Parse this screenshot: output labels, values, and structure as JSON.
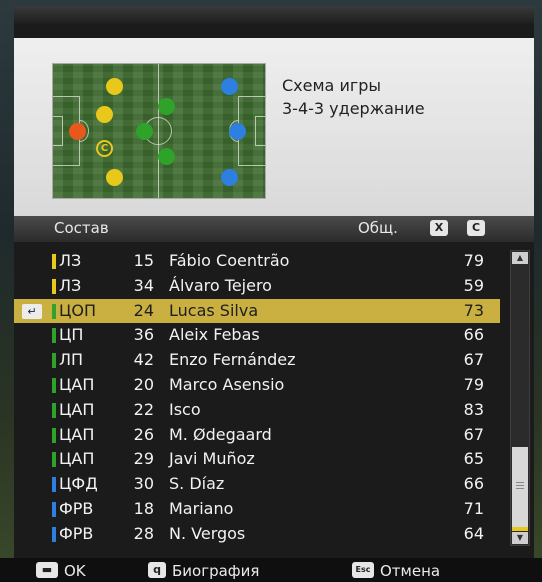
{
  "formation": {
    "title": "Схема игры",
    "name": "3-4-3 удержание"
  },
  "pitch_icons": {
    "captain": "C"
  },
  "list_header": {
    "squad_label": "Состав",
    "ovr_label": "Общ.",
    "key_x": "X",
    "key_c": "C"
  },
  "players": [
    {
      "pos": "ЛЗ",
      "bar_color": "#e8c81a",
      "num": "15",
      "name": "Fábio Coentrão",
      "ovr": "79"
    },
    {
      "pos": "ЛЗ",
      "bar_color": "#e8c81a",
      "num": "34",
      "name": "Álvaro Tejero",
      "ovr": "59"
    },
    {
      "pos": "ЦОП",
      "bar_color": "#2fa22a",
      "num": "24",
      "name": "Lucas Silva",
      "ovr": "73",
      "selected": true
    },
    {
      "pos": "ЦП",
      "bar_color": "#2fa22a",
      "num": "36",
      "name": "Aleix Febas",
      "ovr": "66"
    },
    {
      "pos": "ЛП",
      "bar_color": "#2fa22a",
      "num": "42",
      "name": "Enzo Fernández",
      "ovr": "67"
    },
    {
      "pos": "ЦАП",
      "bar_color": "#2fa22a",
      "num": "20",
      "name": "Marco Asensio",
      "ovr": "79"
    },
    {
      "pos": "ЦАП",
      "bar_color": "#2fa22a",
      "num": "22",
      "name": "Isco",
      "ovr": "83"
    },
    {
      "pos": "ЦАП",
      "bar_color": "#2fa22a",
      "num": "26",
      "name": "M. Ødegaard",
      "ovr": "67"
    },
    {
      "pos": "ЦАП",
      "bar_color": "#2fa22a",
      "num": "29",
      "name": "Javi Muñoz",
      "ovr": "65"
    },
    {
      "pos": "ЦФД",
      "bar_color": "#2d7fe0",
      "num": "30",
      "name": "S. Díaz",
      "ovr": "66"
    },
    {
      "pos": "ФРВ",
      "bar_color": "#2d7fe0",
      "num": "18",
      "name": "Mariano",
      "ovr": "71"
    },
    {
      "pos": "ФРВ",
      "bar_color": "#2d7fe0",
      "num": "28",
      "name": "N. Vergos",
      "ovr": "64"
    }
  ],
  "footer": {
    "ok_label": "OK",
    "bio_key": "q",
    "bio_label": "Биография",
    "esc_key": "Esc",
    "cancel_label": "Отмена"
  },
  "colors": {
    "selected_row": "#c9b040",
    "defender": "#e8c81a",
    "midfielder": "#2fa22a",
    "forward": "#2d7fe0",
    "goalkeeper": "#e8581c"
  }
}
